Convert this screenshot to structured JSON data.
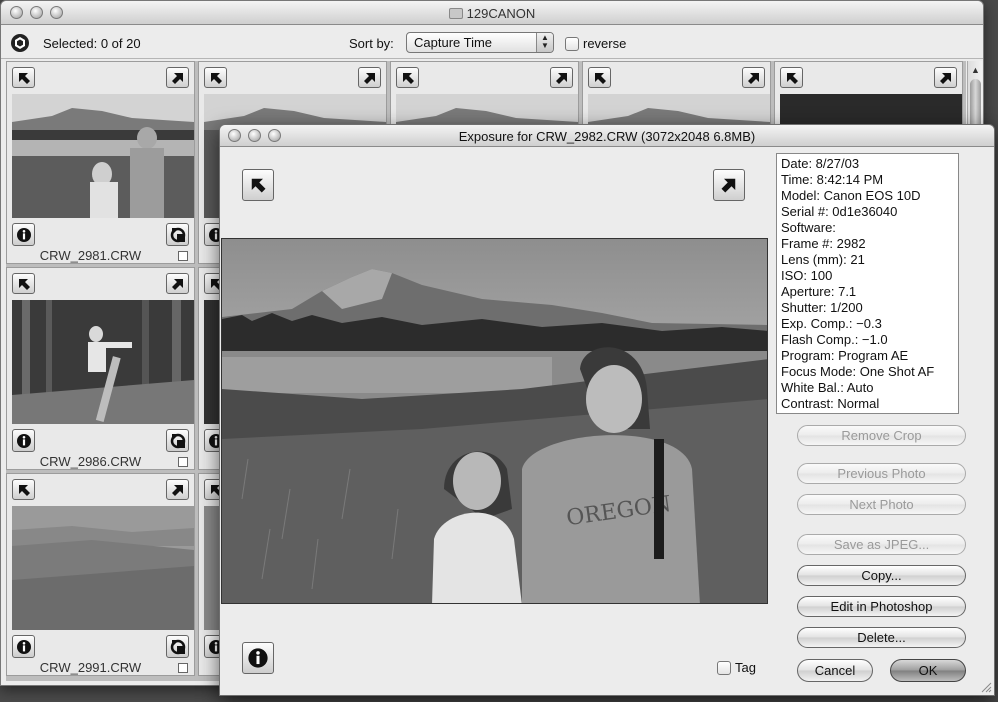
{
  "main_window": {
    "title": "129CANON",
    "selected_text": "Selected: 0 of 20",
    "sort_label": "Sort by:",
    "sort_value": "Capture Time",
    "reverse_label": "reverse"
  },
  "tiles": [
    {
      "filename": "CRW_2981.CRW"
    },
    {
      "filename": "CRW_2986.CRW"
    },
    {
      "filename": "CRW_2991.CRW"
    }
  ],
  "dialog": {
    "title": "Exposure for CRW_2982.CRW (3072x2048 6.8MB)",
    "exif": [
      "Date: 8/27/03",
      "Time: 8:42:14 PM",
      "Model: Canon EOS 10D",
      "Serial #: 0d1e36040",
      "Software:",
      "Frame #: 2982",
      "Lens (mm): 21",
      "ISO: 100",
      "Aperture: 7.1",
      "Shutter: 1/200",
      "Exp. Comp.: −0.3",
      "Flash Comp.: −1.0",
      "Program: Program AE",
      "Focus Mode: One Shot AF",
      "White Bal.: Auto",
      "Contrast: Normal"
    ],
    "buttons": {
      "remove_crop": "Remove Crop",
      "previous_photo": "Previous Photo",
      "next_photo": "Next Photo",
      "save_jpeg": "Save as JPEG...",
      "copy": "Copy...",
      "edit_photoshop": "Edit in Photoshop",
      "delete": "Delete...",
      "cancel": "Cancel",
      "ok": "OK"
    },
    "tag_label": "Tag"
  }
}
